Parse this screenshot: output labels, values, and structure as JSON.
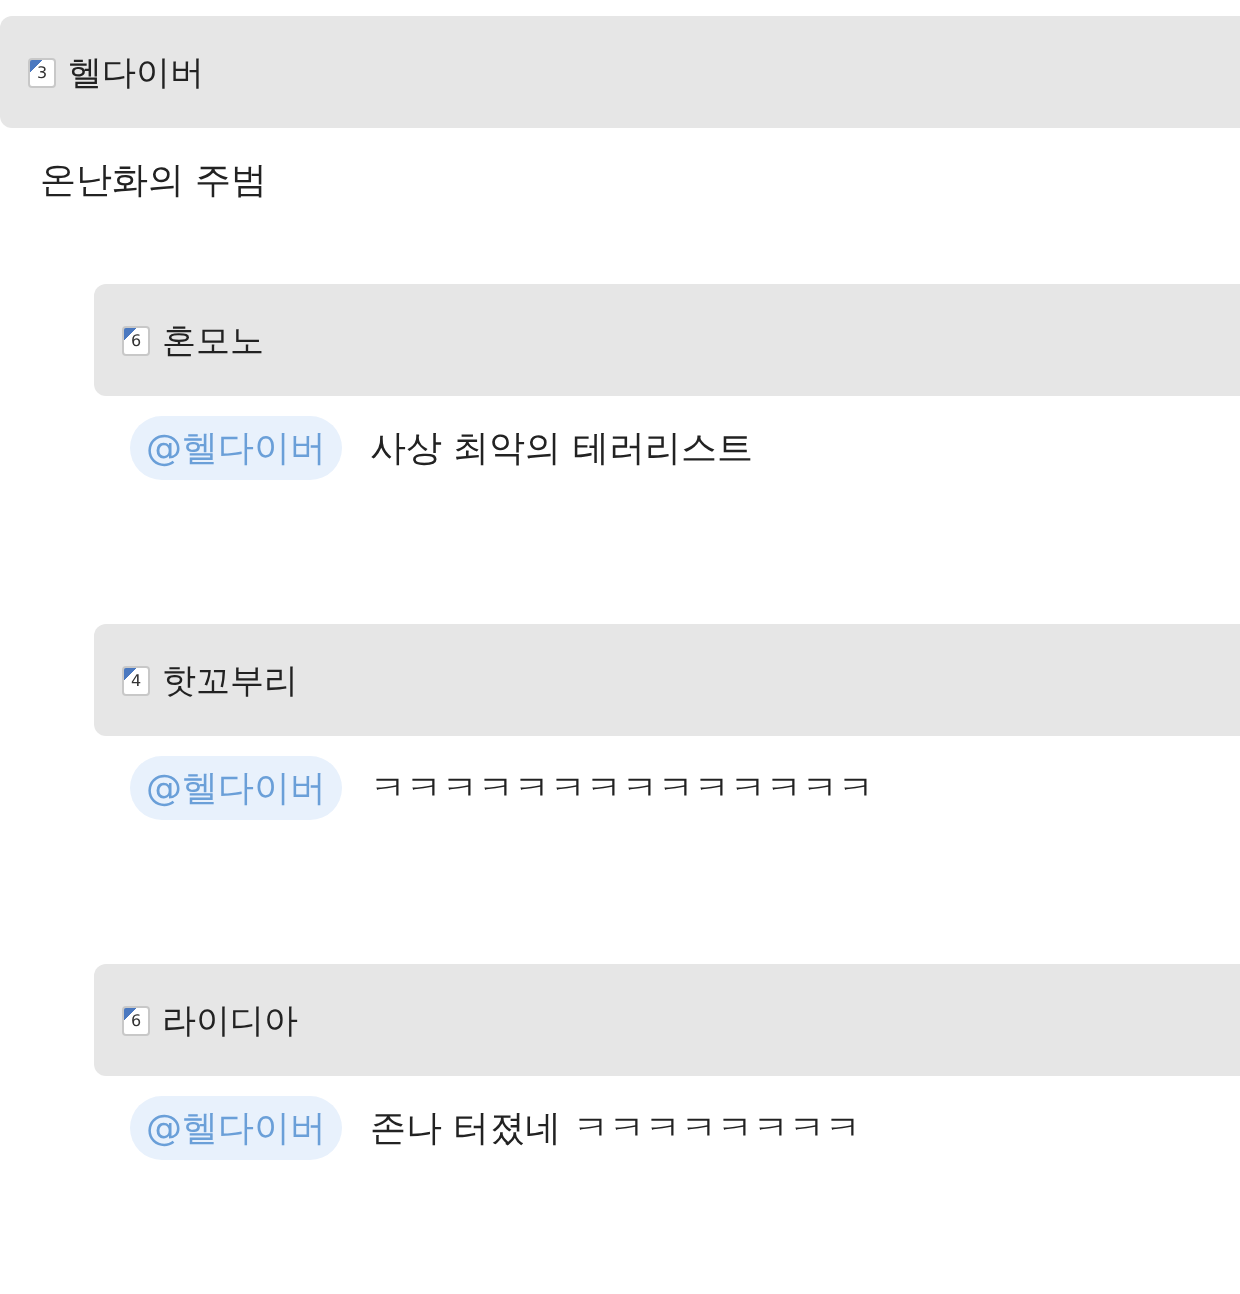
{
  "comment": {
    "level": "3",
    "author": "헬다이버",
    "text": "온난화의 주범",
    "replies": [
      {
        "level": "6",
        "author": "혼모노",
        "mention": "@헬다이버",
        "text": "사상 최악의 테러리스트"
      },
      {
        "level": "4",
        "author": "핫꼬부리",
        "mention": "@헬다이버",
        "text": "ㅋㅋㅋㅋㅋㅋㅋㅋㅋㅋㅋㅋㅋㅋ"
      },
      {
        "level": "6",
        "author": "라이디아",
        "mention": "@헬다이버",
        "text": "존나 터졌네 ㅋㅋㅋㅋㅋㅋㅋㅋ"
      }
    ]
  }
}
